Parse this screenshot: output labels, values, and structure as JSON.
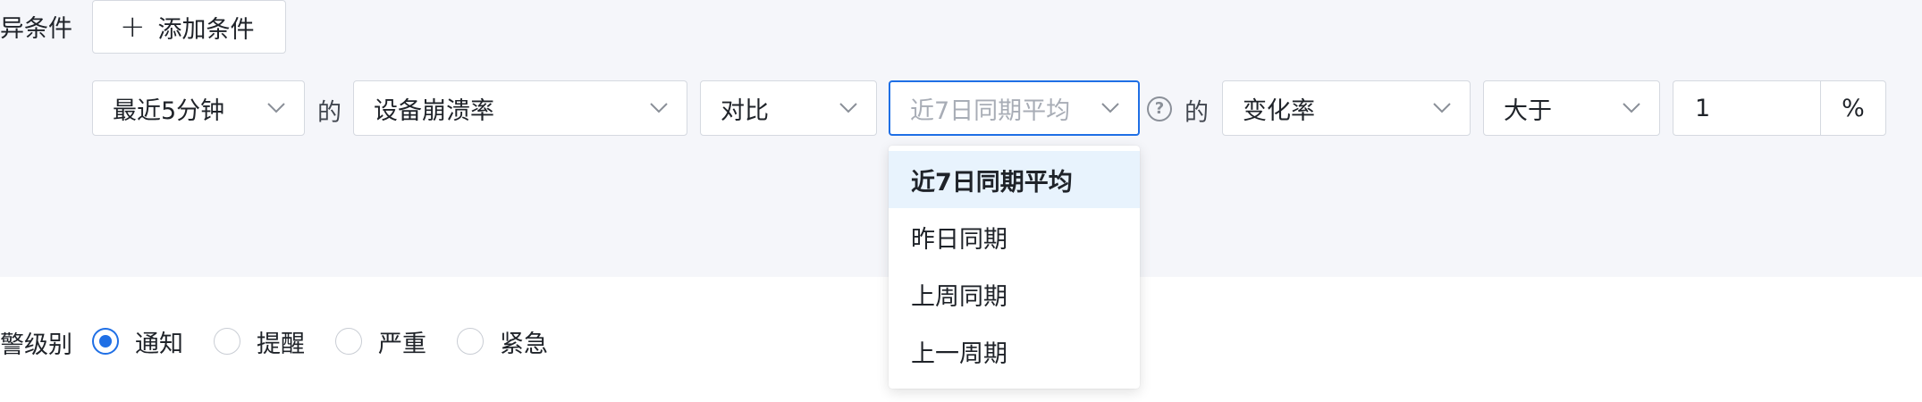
{
  "condition": {
    "section_label": "异条件",
    "add_button_label": "添加条件",
    "time_window": "最近5分钟",
    "connector_1": "的",
    "metric": "设备崩溃率",
    "compare_mode": "对比",
    "baseline_placeholder": "近7日同期平均",
    "connector_2": "的",
    "change_type": "变化率",
    "operator": "大于",
    "threshold_value": "1",
    "threshold_unit": "%"
  },
  "baseline_dropdown": {
    "options": [
      {
        "label": "近7日同期平均",
        "selected": true
      },
      {
        "label": "昨日同期",
        "selected": false
      },
      {
        "label": "上周同期",
        "selected": false
      },
      {
        "label": "上一周期",
        "selected": false
      }
    ]
  },
  "alert_level": {
    "label": "警级别",
    "options": [
      {
        "label": "通知",
        "checked": true
      },
      {
        "label": "提醒",
        "checked": false
      },
      {
        "label": "严重",
        "checked": false
      },
      {
        "label": "紧急",
        "checked": false
      }
    ]
  },
  "colors": {
    "accent": "#1f6fe5",
    "panel_bg": "#f5f6fa",
    "selected_option_bg": "#e8f3fd",
    "border": "#d5d9e0"
  }
}
